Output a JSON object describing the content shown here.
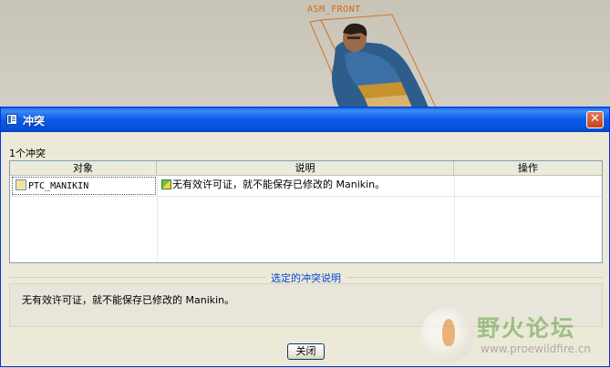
{
  "viewport": {
    "datum_label": "ASM_FRONT"
  },
  "dialog": {
    "title": "冲突",
    "close_glyph": "✕",
    "conflict_count": "1个冲突",
    "table": {
      "columns": [
        "对象",
        "说明",
        "操作"
      ],
      "rows": [
        {
          "object": "PTC_MANIKIN",
          "description": "无有效许可证，就不能保存已修改的 Manikin。",
          "action": ""
        }
      ]
    },
    "explain": {
      "legend": "选定的冲突说明",
      "text": "无有效许可证，就不能保存已修改的 Manikin。"
    },
    "close_button": "关闭"
  },
  "watermark": {
    "name": "野火论坛",
    "url": "www.proewildfire.cn"
  },
  "colors": {
    "titlebar": "#0a5ae8",
    "legend": "#0046d5",
    "datum": "#d26a12"
  }
}
